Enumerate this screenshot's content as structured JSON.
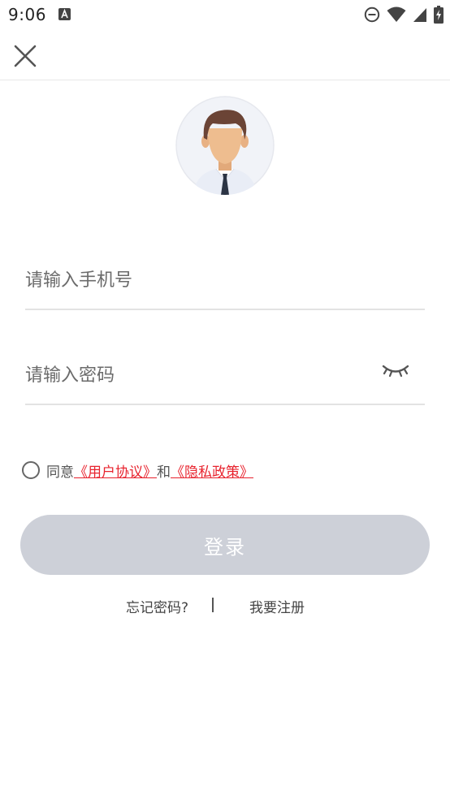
{
  "status_bar": {
    "time": "9:06",
    "left_icons": [
      "keyboard-a-icon"
    ],
    "right_icons": [
      "do-not-disturb-icon",
      "wifi-icon",
      "signal-icon",
      "battery-charging-icon"
    ]
  },
  "top_bar": {
    "close_icon": "close-icon"
  },
  "avatar": {
    "icon": "user-avatar-icon"
  },
  "form": {
    "phone_placeholder": "请输入手机号",
    "phone_value": "",
    "password_placeholder": "请输入密码",
    "password_value": "",
    "eye_icon": "eye-closed-icon"
  },
  "agreement": {
    "checked": false,
    "agree_text": "同意",
    "user_agreement_link": "《用户协议》",
    "and_text": "和",
    "privacy_policy_link": "《隐私政策》"
  },
  "login_button": {
    "label": "登录"
  },
  "bottom_links": {
    "forgot_password": "忘记密码?",
    "register": "我要注册"
  },
  "colors": {
    "accent_link": "#e8232e",
    "button_disabled_bg": "#cdd0d8"
  }
}
